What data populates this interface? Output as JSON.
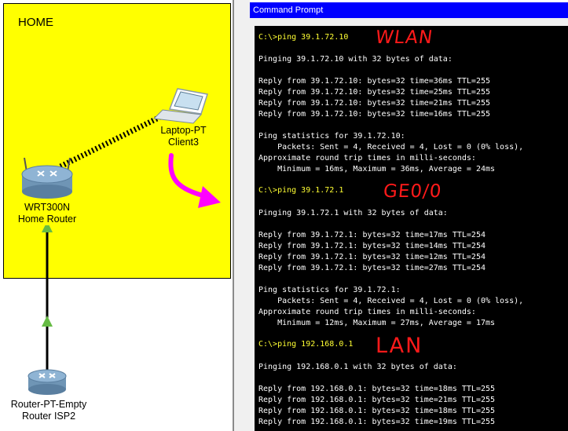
{
  "colors": {
    "zone_bg": "#ffff00",
    "cmd_titlebar": "#0000ff",
    "console_bg": "#000000",
    "prompt_text": "#ffff33",
    "note_red": "#ff1a1a",
    "arrow_magenta": "#ff00ff",
    "link_green": "#66bb44"
  },
  "topology": {
    "zone_label": "HOME",
    "devices": {
      "laptop": {
        "icon": "laptop-icon",
        "name": "Laptop-PT",
        "label": "Client3"
      },
      "home_router": {
        "icon": "wireless-router-icon",
        "name": "WRT300N",
        "label": "Home Router"
      },
      "isp_router": {
        "icon": "router-icon",
        "name": "Router-PT-Empty",
        "label": "Router ISP2"
      }
    }
  },
  "cmd": {
    "title": "Command Prompt",
    "annotations": {
      "wlan": "WLAN",
      "ge": "GE0/0",
      "lan": "LAN"
    },
    "lines": [
      {
        "t": "C:\\>ping 39.1.72.10",
        "p": 1
      },
      {
        "t": "Pinging 39.1.72.10 with 32 bytes of data:"
      },
      {
        "t": "Reply from 39.1.72.10: bytes=32 time=36ms TTL=255"
      },
      {
        "t": "Reply from 39.1.72.10: bytes=32 time=25ms TTL=255"
      },
      {
        "t": "Reply from 39.1.72.10: bytes=32 time=21ms TTL=255"
      },
      {
        "t": "Reply from 39.1.72.10: bytes=32 time=16ms TTL=255"
      },
      {
        "t": "Ping statistics for 39.1.72.10:"
      },
      {
        "t": "    Packets: Sent = 4, Received = 4, Lost = 0 (0% loss),"
      },
      {
        "t": "Approximate round trip times in milli-seconds:"
      },
      {
        "t": "    Minimum = 16ms, Maximum = 36ms, Average = 24ms"
      },
      {
        "t": "C:\\>ping 39.1.72.1",
        "p": 1
      },
      {
        "t": "Pinging 39.1.72.1 with 32 bytes of data:"
      },
      {
        "t": "Reply from 39.1.72.1: bytes=32 time=17ms TTL=254"
      },
      {
        "t": "Reply from 39.1.72.1: bytes=32 time=14ms TTL=254"
      },
      {
        "t": "Reply from 39.1.72.1: bytes=32 time=12ms TTL=254"
      },
      {
        "t": "Reply from 39.1.72.1: bytes=32 time=27ms TTL=254"
      },
      {
        "t": "Ping statistics for 39.1.72.1:"
      },
      {
        "t": "    Packets: Sent = 4, Received = 4, Lost = 0 (0% loss),"
      },
      {
        "t": "Approximate round trip times in milli-seconds:"
      },
      {
        "t": "    Minimum = 12ms, Maximum = 27ms, Average = 17ms"
      },
      {
        "t": "C:\\>ping 192.168.0.1",
        "p": 1
      },
      {
        "t": "Pinging 192.168.0.1 with 32 bytes of data:"
      },
      {
        "t": "Reply from 192.168.0.1: bytes=32 time=18ms TTL=255"
      },
      {
        "t": "Reply from 192.168.0.1: bytes=32 time=21ms TTL=255"
      },
      {
        "t": "Reply from 192.168.0.1: bytes=32 time=18ms TTL=255"
      },
      {
        "t": "Reply from 192.168.0.1: bytes=32 time=19ms TTL=255"
      }
    ]
  }
}
